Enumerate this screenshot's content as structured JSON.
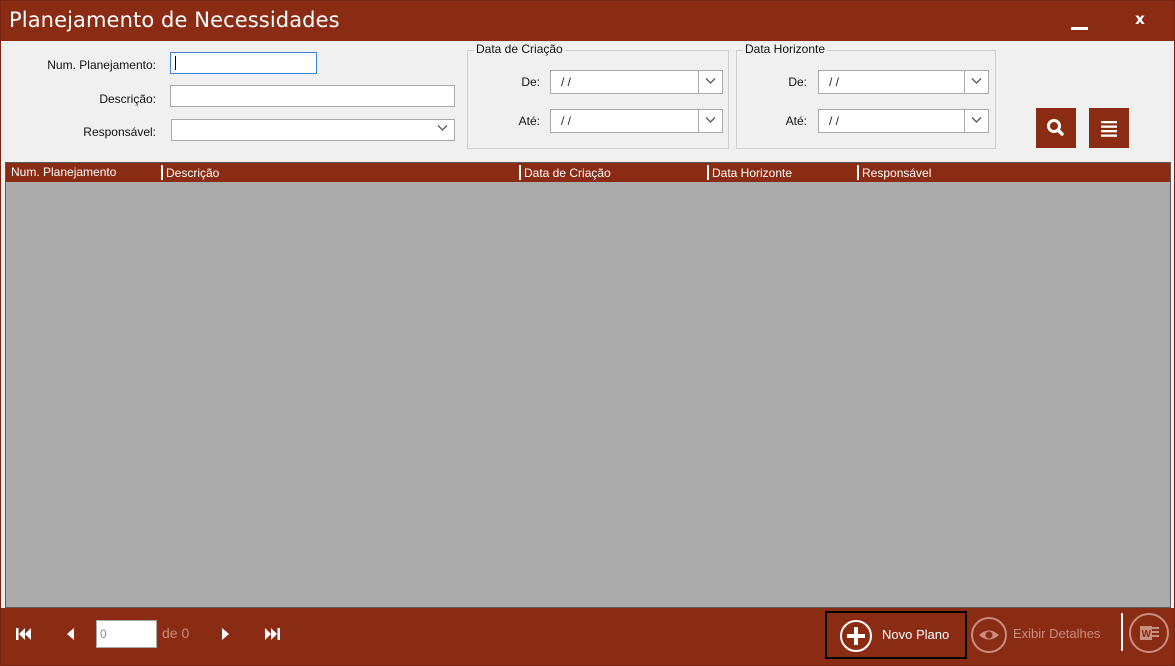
{
  "window": {
    "title": "Planejamento de Necessidades",
    "minimize_label": "—",
    "close_label": "x"
  },
  "filters": {
    "num_planejamento_label": "Num. Planejamento:",
    "num_planejamento_value": "",
    "descricao_label": "Descrição:",
    "descricao_value": "",
    "responsavel_label": "Responsável:",
    "responsavel_value": "",
    "data_criacao": {
      "title": "Data de Criação",
      "de_label": "De:",
      "de_value": "/ /",
      "ate_label": "Até:",
      "ate_value": "/ /"
    },
    "data_horizonte": {
      "title": "Data Horizonte",
      "de_label": "De:",
      "de_value": "/ /",
      "ate_label": "Até:",
      "ate_value": "/ /"
    },
    "search_icon": "search-icon",
    "list_icon": "menu-list-icon"
  },
  "grid": {
    "columns": [
      "Num. Planejamento",
      "Descrição",
      "Data de Criação",
      "Data Horizonte",
      "Responsável"
    ],
    "rows": []
  },
  "footer": {
    "page_value": "0",
    "page_of": "de 0",
    "novo_plano": "Novo Plano",
    "exibir_detalhes": "Exibir Detalhes"
  },
  "colors": {
    "brand": "#8a2b13",
    "grid_bg": "#ababab",
    "focus_border": "#3c7fd6"
  }
}
